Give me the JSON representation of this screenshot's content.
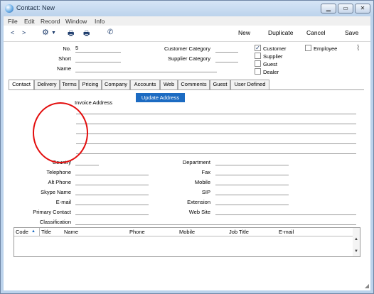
{
  "window": {
    "title": "Contact: New"
  },
  "menu": [
    "File",
    "Edit",
    "Record",
    "Window",
    "Info"
  ],
  "toolbar": {
    "new": "New",
    "duplicate": "Duplicate",
    "cancel": "Cancel",
    "save": "Save"
  },
  "header": {
    "no_label": "No.",
    "no_value": "5",
    "short_label": "Short",
    "name_label": "Name",
    "customer_category_label": "Customer Category",
    "supplier_category_label": "Supplier Category",
    "customer_label": "Customer",
    "customer_checked": true,
    "supplier_label": "Supplier",
    "guest_label": "Guest",
    "dealer_label": "Dealer",
    "employee_label": "Employee"
  },
  "tabs": [
    "Contact",
    "Delivery",
    "Terms",
    "Pricing",
    "Company",
    "Accounts",
    "Web",
    "Comments",
    "Guest",
    "User Defined"
  ],
  "contact": {
    "update_address": "Update Address",
    "invoice_address": "Invoice Address",
    "country": "Country",
    "telephone": "Telephone",
    "alt_phone": "Alt Phone",
    "skype_name": "Skype Name",
    "email": "E-mail",
    "primary_contact": "Primary Contact",
    "classification": "Classification",
    "department": "Department",
    "fax": "Fax",
    "mobile": "Mobile",
    "sip": "SIP",
    "extension": "Extension",
    "web_site": "Web Site"
  },
  "grid_columns": [
    "Code",
    "Title",
    "Name",
    "Phone",
    "Mobile",
    "Job Title",
    "E-mail"
  ]
}
